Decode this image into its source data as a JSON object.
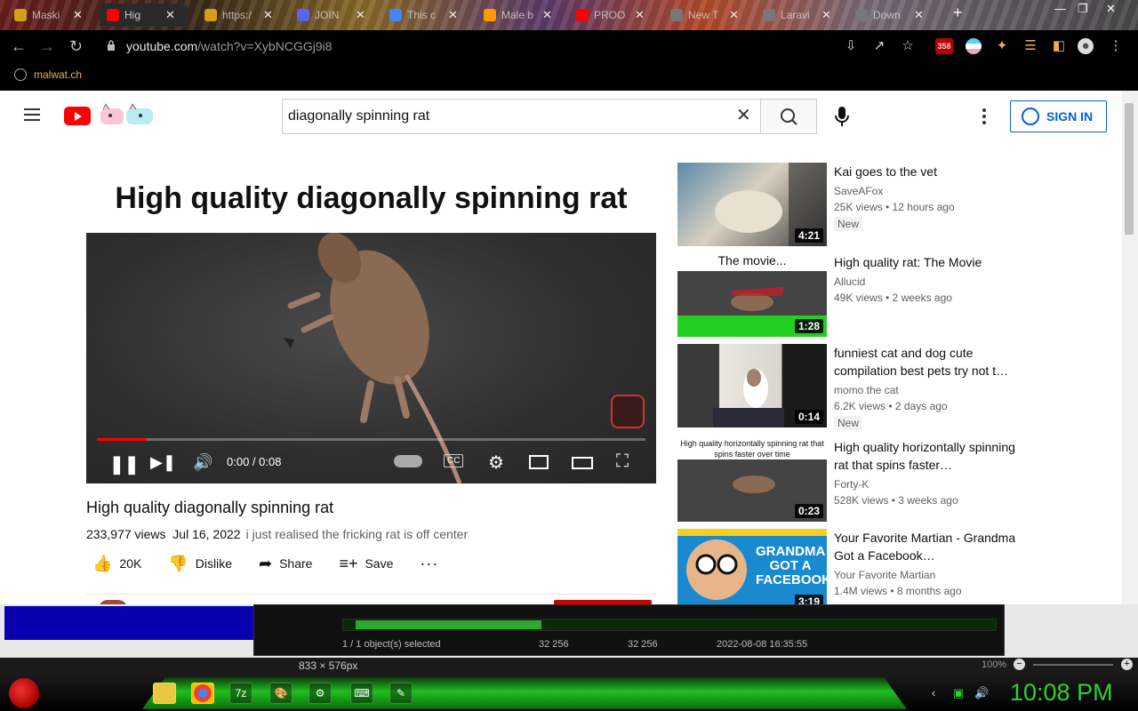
{
  "browser": {
    "tabs": [
      {
        "title": "Maski",
        "color": "#d4a017"
      },
      {
        "title": "Hig",
        "color": "#ff0000"
      },
      {
        "title": "https:/",
        "color": "#d4a017"
      },
      {
        "title": "JOIN",
        "color": "#5865f2"
      },
      {
        "title": "This c",
        "color": "#4285f4"
      },
      {
        "title": "Male b",
        "color": "#ff9900"
      },
      {
        "title": "PROO",
        "color": "#ff0000"
      },
      {
        "title": "New T",
        "color": "#777777"
      },
      {
        "title": "Laravi",
        "color": "#777777"
      },
      {
        "title": "Down",
        "color": "#777777"
      }
    ],
    "url_host": "youtube.com",
    "url_path": "/watch?v=XybNCGGj9i8",
    "extension_badge": "358",
    "bookmark": "malwat.ch"
  },
  "youtube": {
    "search_value": "diagonally spinning rat",
    "sign_in": "SIGN IN",
    "player": {
      "banner": "High quality diagonally spinning rat",
      "time": "0:00 / 0:08",
      "progress": 0.09
    },
    "video": {
      "title": "High quality diagonally spinning rat",
      "views": "233,977 views",
      "date": "Jul 16, 2022",
      "description": "i just realised the fricking rat is off center",
      "likes": "20K",
      "dislike": "Dislike",
      "share": "Share",
      "save": "Save"
    },
    "recommendations": [
      {
        "title": "Kai goes to the vet",
        "channel": "SaveAFox",
        "stats": "25K views • 12 hours ago",
        "badge": "New",
        "duration": "4:21"
      },
      {
        "title": "High quality rat: The Movie",
        "channel": "Allucid",
        "stats": "49K views • 2 weeks ago",
        "badge": "",
        "duration": "1:28",
        "thumb_text": "The movie..."
      },
      {
        "title": "funniest cat and dog cute compilation best pets try not t…",
        "channel": "momo the cat",
        "stats": "6.2K views • 2 days ago",
        "badge": "New",
        "duration": "0:14"
      },
      {
        "title": "High quality horizontally spinning rat that spins faster…",
        "channel": "Forty-K",
        "stats": "528K views • 3 weeks ago",
        "badge": "",
        "duration": "0:23",
        "thumb_text": "High quality horizontally spinning rat that spins faster over time"
      },
      {
        "title": "Your Favorite Martian - Grandma Got a Facebook…",
        "channel": "Your Favorite Martian",
        "stats": "1.4M views • 8 months ago",
        "badge": "",
        "duration": "3:19",
        "thumb_text": "GRANDMA GOT A FACEBOOK"
      }
    ]
  },
  "overlay_app": {
    "status": "1 / 1 object(s) selected",
    "val1": "32 256",
    "val2": "32 256",
    "datetime": "2022-08-08 16:35:55",
    "dims": "833 × 576px",
    "zoom": "100%"
  },
  "taskbar": {
    "clock": "10:08 PM"
  }
}
